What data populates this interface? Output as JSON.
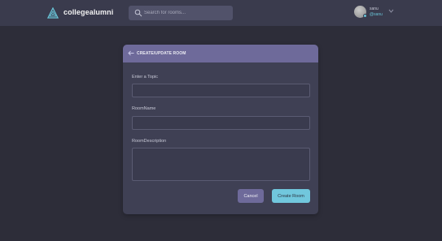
{
  "header": {
    "brand": "collegealumni",
    "search_placeholder": "Search for rooms...",
    "user": {
      "name": "sanu",
      "handle": "@sanu"
    }
  },
  "card": {
    "title": "CREATE/UPDATE ROOM",
    "fields": {
      "topic_label": "Enter a Topic",
      "name_label": "RoomName",
      "description_label": "RoomDescription"
    },
    "buttons": {
      "cancel": "Cancel",
      "create": "Create Room"
    }
  },
  "colors": {
    "background": "#2d2d39",
    "header": "#3a3b4d",
    "accent": "#71c7dd",
    "card_header": "#6e6a9a",
    "card": "#3f4054"
  },
  "icons": [
    "logo-icon",
    "search-icon",
    "avatar",
    "chevron-down-icon",
    "back-arrow-icon"
  ]
}
